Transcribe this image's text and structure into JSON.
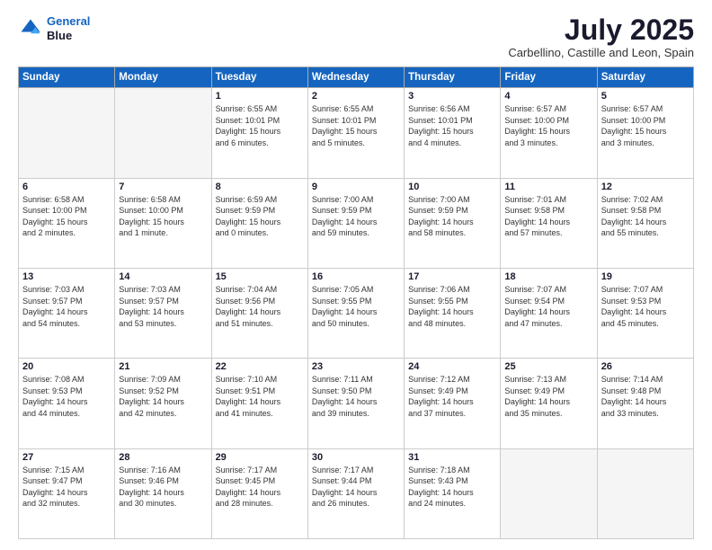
{
  "header": {
    "logo_line1": "General",
    "logo_line2": "Blue",
    "month_title": "July 2025",
    "subtitle": "Carbellino, Castille and Leon, Spain"
  },
  "weekdays": [
    "Sunday",
    "Monday",
    "Tuesday",
    "Wednesday",
    "Thursday",
    "Friday",
    "Saturday"
  ],
  "weeks": [
    [
      {
        "day": "",
        "info": ""
      },
      {
        "day": "",
        "info": ""
      },
      {
        "day": "1",
        "info": "Sunrise: 6:55 AM\nSunset: 10:01 PM\nDaylight: 15 hours\nand 6 minutes."
      },
      {
        "day": "2",
        "info": "Sunrise: 6:55 AM\nSunset: 10:01 PM\nDaylight: 15 hours\nand 5 minutes."
      },
      {
        "day": "3",
        "info": "Sunrise: 6:56 AM\nSunset: 10:01 PM\nDaylight: 15 hours\nand 4 minutes."
      },
      {
        "day": "4",
        "info": "Sunrise: 6:57 AM\nSunset: 10:00 PM\nDaylight: 15 hours\nand 3 minutes."
      },
      {
        "day": "5",
        "info": "Sunrise: 6:57 AM\nSunset: 10:00 PM\nDaylight: 15 hours\nand 3 minutes."
      }
    ],
    [
      {
        "day": "6",
        "info": "Sunrise: 6:58 AM\nSunset: 10:00 PM\nDaylight: 15 hours\nand 2 minutes."
      },
      {
        "day": "7",
        "info": "Sunrise: 6:58 AM\nSunset: 10:00 PM\nDaylight: 15 hours\nand 1 minute."
      },
      {
        "day": "8",
        "info": "Sunrise: 6:59 AM\nSunset: 9:59 PM\nDaylight: 15 hours\nand 0 minutes."
      },
      {
        "day": "9",
        "info": "Sunrise: 7:00 AM\nSunset: 9:59 PM\nDaylight: 14 hours\nand 59 minutes."
      },
      {
        "day": "10",
        "info": "Sunrise: 7:00 AM\nSunset: 9:59 PM\nDaylight: 14 hours\nand 58 minutes."
      },
      {
        "day": "11",
        "info": "Sunrise: 7:01 AM\nSunset: 9:58 PM\nDaylight: 14 hours\nand 57 minutes."
      },
      {
        "day": "12",
        "info": "Sunrise: 7:02 AM\nSunset: 9:58 PM\nDaylight: 14 hours\nand 55 minutes."
      }
    ],
    [
      {
        "day": "13",
        "info": "Sunrise: 7:03 AM\nSunset: 9:57 PM\nDaylight: 14 hours\nand 54 minutes."
      },
      {
        "day": "14",
        "info": "Sunrise: 7:03 AM\nSunset: 9:57 PM\nDaylight: 14 hours\nand 53 minutes."
      },
      {
        "day": "15",
        "info": "Sunrise: 7:04 AM\nSunset: 9:56 PM\nDaylight: 14 hours\nand 51 minutes."
      },
      {
        "day": "16",
        "info": "Sunrise: 7:05 AM\nSunset: 9:55 PM\nDaylight: 14 hours\nand 50 minutes."
      },
      {
        "day": "17",
        "info": "Sunrise: 7:06 AM\nSunset: 9:55 PM\nDaylight: 14 hours\nand 48 minutes."
      },
      {
        "day": "18",
        "info": "Sunrise: 7:07 AM\nSunset: 9:54 PM\nDaylight: 14 hours\nand 47 minutes."
      },
      {
        "day": "19",
        "info": "Sunrise: 7:07 AM\nSunset: 9:53 PM\nDaylight: 14 hours\nand 45 minutes."
      }
    ],
    [
      {
        "day": "20",
        "info": "Sunrise: 7:08 AM\nSunset: 9:53 PM\nDaylight: 14 hours\nand 44 minutes."
      },
      {
        "day": "21",
        "info": "Sunrise: 7:09 AM\nSunset: 9:52 PM\nDaylight: 14 hours\nand 42 minutes."
      },
      {
        "day": "22",
        "info": "Sunrise: 7:10 AM\nSunset: 9:51 PM\nDaylight: 14 hours\nand 41 minutes."
      },
      {
        "day": "23",
        "info": "Sunrise: 7:11 AM\nSunset: 9:50 PM\nDaylight: 14 hours\nand 39 minutes."
      },
      {
        "day": "24",
        "info": "Sunrise: 7:12 AM\nSunset: 9:49 PM\nDaylight: 14 hours\nand 37 minutes."
      },
      {
        "day": "25",
        "info": "Sunrise: 7:13 AM\nSunset: 9:49 PM\nDaylight: 14 hours\nand 35 minutes."
      },
      {
        "day": "26",
        "info": "Sunrise: 7:14 AM\nSunset: 9:48 PM\nDaylight: 14 hours\nand 33 minutes."
      }
    ],
    [
      {
        "day": "27",
        "info": "Sunrise: 7:15 AM\nSunset: 9:47 PM\nDaylight: 14 hours\nand 32 minutes."
      },
      {
        "day": "28",
        "info": "Sunrise: 7:16 AM\nSunset: 9:46 PM\nDaylight: 14 hours\nand 30 minutes."
      },
      {
        "day": "29",
        "info": "Sunrise: 7:17 AM\nSunset: 9:45 PM\nDaylight: 14 hours\nand 28 minutes."
      },
      {
        "day": "30",
        "info": "Sunrise: 7:17 AM\nSunset: 9:44 PM\nDaylight: 14 hours\nand 26 minutes."
      },
      {
        "day": "31",
        "info": "Sunrise: 7:18 AM\nSunset: 9:43 PM\nDaylight: 14 hours\nand 24 minutes."
      },
      {
        "day": "",
        "info": ""
      },
      {
        "day": "",
        "info": ""
      }
    ]
  ]
}
